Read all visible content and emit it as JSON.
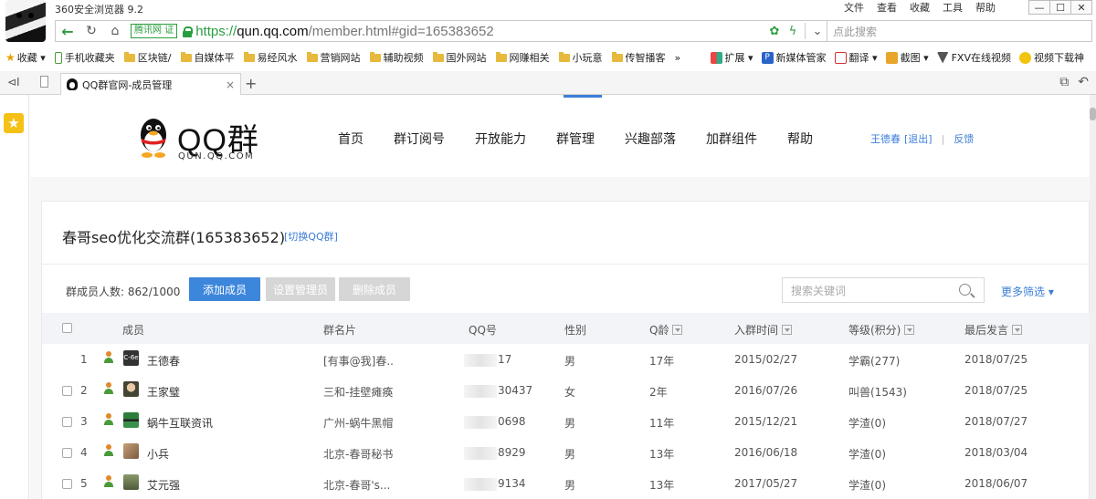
{
  "browser": {
    "title": "360安全浏览器 9.2",
    "menu": [
      "文件",
      "查看",
      "收藏",
      "工具",
      "帮助"
    ],
    "window_controls": [
      "—",
      "☐",
      "✕"
    ],
    "address": {
      "badge": "腾讯网",
      "badge_mark": "证",
      "url_scheme": "https://",
      "url_host": "qun.qq.com",
      "url_rest": "/member.html#gid=165383652",
      "search_placeholder": "点此搜索"
    },
    "bookmarks": {
      "favorites_label": "收藏",
      "items": [
        "手机收藏夹",
        "区块链/",
        "自媒体平",
        "易经风水",
        "营销网站",
        "辅助视频",
        "国外网站",
        "网赚相关",
        "小玩意",
        "传智播客"
      ],
      "more": "»",
      "right_items": [
        "扩展",
        "新媒体管家",
        "翻译",
        "截图",
        "FXV在线视频",
        "视频下载神"
      ]
    },
    "tab": {
      "title": "QQ群官网-成员管理",
      "close": "×",
      "add": "+"
    }
  },
  "site": {
    "logo_text": "QQ群",
    "logo_sub": "QUN.QQ.COM",
    "nav": [
      "首页",
      "群订阅号",
      "开放能力",
      "群管理",
      "兴趣部落",
      "加群组件",
      "帮助"
    ],
    "user_name": "王德春",
    "logout": "[退出]",
    "divider": "|",
    "feedback": "反馈"
  },
  "group": {
    "title": "春哥seo优化交流群(165383652)",
    "switch_label": "[切换QQ群]",
    "member_count_label": "群成员人数: 862/1000",
    "buttons": {
      "add": "添加成员",
      "set_admin": "设置管理员",
      "delete": "删除成员"
    },
    "search_placeholder": "搜索关键词",
    "more_filter": "更多筛选 ▾"
  },
  "table": {
    "columns": [
      "成员",
      "群名片",
      "QQ号",
      "性别",
      "Q龄",
      "入群时间",
      "等级(积分)",
      "最后发言"
    ],
    "rows": [
      {
        "num": "1",
        "name": "王德春",
        "card": "[有事@我]春..",
        "qq": "17",
        "gender": "男",
        "qage": "17年",
        "joined": "2015/02/27",
        "level": "学霸(277)",
        "last": "2018/07/25"
      },
      {
        "num": "2",
        "name": "王家璧",
        "card": "三和-挂壁瘫痪",
        "qq": "30437",
        "gender": "女",
        "qage": "2年",
        "joined": "2016/07/26",
        "level": "叫兽(1543)",
        "last": "2018/07/25"
      },
      {
        "num": "3",
        "name": "蜗牛互联资讯",
        "card": "广州-蜗牛黑帽",
        "qq": "0698",
        "gender": "男",
        "qage": "11年",
        "joined": "2015/12/21",
        "level": "学渣(0)",
        "last": "2018/07/27"
      },
      {
        "num": "4",
        "name": "小兵",
        "card": "北京-春哥秘书",
        "qq": "8929",
        "gender": "男",
        "qage": "13年",
        "joined": "2016/06/18",
        "level": "学渣(0)",
        "last": "2018/03/04"
      },
      {
        "num": "5",
        "name": "艾元强",
        "card": "北京-春哥's...",
        "qq": "9134",
        "gender": "男",
        "qage": "13年",
        "joined": "2017/05/27",
        "level": "学渣(0)",
        "last": "2018/06/07"
      }
    ]
  },
  "colors": {
    "accent_blue": "#3c86dc",
    "link_blue": "#3c7ed8",
    "secure_green": "#2a9e3f"
  }
}
